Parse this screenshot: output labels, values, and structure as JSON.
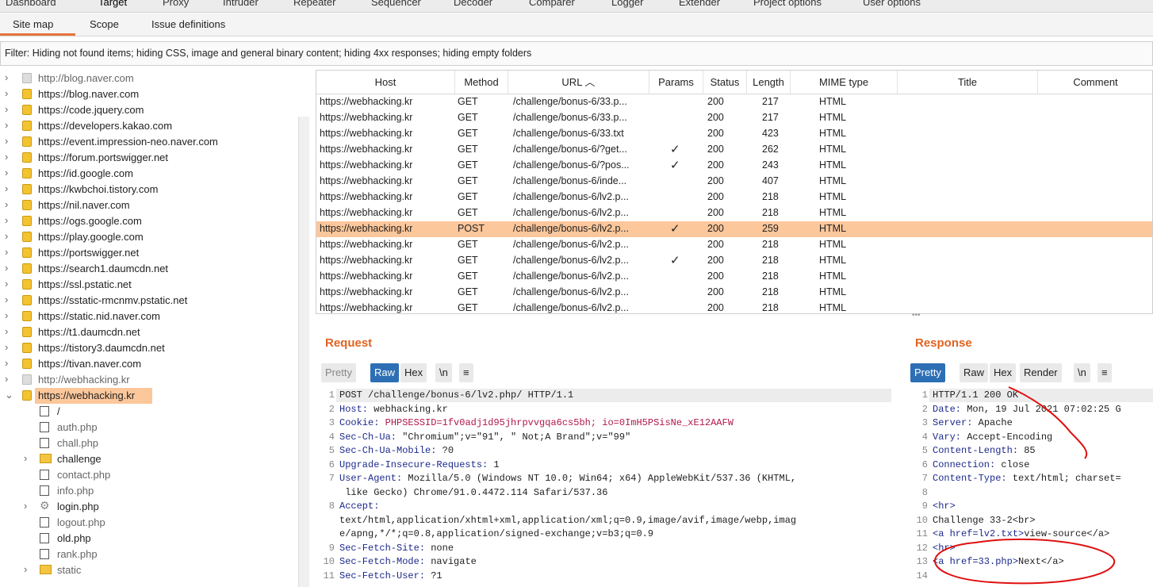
{
  "top_tabs": [
    "Dashboard",
    "Target",
    "Proxy",
    "Intruder",
    "Repeater",
    "Sequencer",
    "Decoder",
    "Comparer",
    "Logger",
    "Extender",
    "Project options",
    "User options"
  ],
  "sub_tabs": [
    "Site map",
    "Scope",
    "Issue definitions"
  ],
  "filter_text": "Filter: Hiding not found items;  hiding CSS, image and general binary content;  hiding 4xx responses;  hiding empty folders",
  "tree": {
    "hosts": [
      {
        "label": "http://blog.naver.com",
        "icon": "host-gray-icon"
      },
      {
        "label": "https://blog.naver.com",
        "icon": "lock-icon"
      },
      {
        "label": "https://code.jquery.com",
        "icon": "lock-icon"
      },
      {
        "label": "https://developers.kakao.com",
        "icon": "lock-icon"
      },
      {
        "label": "https://event.impression-neo.naver.com",
        "icon": "lock-icon"
      },
      {
        "label": "https://forum.portswigger.net",
        "icon": "lock-icon"
      },
      {
        "label": "https://id.google.com",
        "icon": "lock-icon"
      },
      {
        "label": "https://kwbchoi.tistory.com",
        "icon": "lock-icon"
      },
      {
        "label": "https://nil.naver.com",
        "icon": "lock-icon"
      },
      {
        "label": "https://ogs.google.com",
        "icon": "lock-icon"
      },
      {
        "label": "https://play.google.com",
        "icon": "lock-icon"
      },
      {
        "label": "https://portswigger.net",
        "icon": "lock-icon"
      },
      {
        "label": "https://search1.daumcdn.net",
        "icon": "lock-icon"
      },
      {
        "label": "https://ssl.pstatic.net",
        "icon": "lock-icon"
      },
      {
        "label": "https://sstatic-rmcnmv.pstatic.net",
        "icon": "lock-icon"
      },
      {
        "label": "https://static.nid.naver.com",
        "icon": "lock-icon"
      },
      {
        "label": "https://t1.daumcdn.net",
        "icon": "lock-icon"
      },
      {
        "label": "https://tistory3.daumcdn.net",
        "icon": "lock-icon"
      },
      {
        "label": "https://tivan.naver.com",
        "icon": "lock-icon"
      },
      {
        "label": "http://webhacking.kr",
        "icon": "host-gray-icon"
      },
      {
        "label": "https://webhacking.kr",
        "icon": "lock-icon"
      }
    ],
    "children": [
      {
        "label": "/",
        "icon": "file-icon"
      },
      {
        "label": "auth.php",
        "icon": "file-icon"
      },
      {
        "label": "chall.php",
        "icon": "file-icon"
      },
      {
        "label": "challenge",
        "icon": "folder-icon"
      },
      {
        "label": "contact.php",
        "icon": "file-icon"
      },
      {
        "label": "info.php",
        "icon": "file-icon"
      },
      {
        "label": "login.php",
        "icon": "gear-icon"
      },
      {
        "label": "logout.php",
        "icon": "file-icon"
      },
      {
        "label": "old.php",
        "icon": "file-icon"
      },
      {
        "label": "rank.php",
        "icon": "file-icon"
      },
      {
        "label": "static",
        "icon": "folder-icon"
      }
    ]
  },
  "table": {
    "headers": [
      "Host",
      "Method",
      "URL ^",
      "Params",
      "Status",
      "Length",
      "MIME type",
      "Title",
      "Comment"
    ],
    "rows": [
      {
        "host": "https://webhacking.kr",
        "method": "GET",
        "url": "/challenge/bonus-6/33.p...",
        "params": "",
        "status": "200",
        "length": "217",
        "mime": "HTML"
      },
      {
        "host": "https://webhacking.kr",
        "method": "GET",
        "url": "/challenge/bonus-6/33.p...",
        "params": "",
        "status": "200",
        "length": "217",
        "mime": "HTML"
      },
      {
        "host": "https://webhacking.kr",
        "method": "GET",
        "url": "/challenge/bonus-6/33.txt",
        "params": "",
        "status": "200",
        "length": "423",
        "mime": "HTML"
      },
      {
        "host": "https://webhacking.kr",
        "method": "GET",
        "url": "/challenge/bonus-6/?get...",
        "params": "✓",
        "status": "200",
        "length": "262",
        "mime": "HTML"
      },
      {
        "host": "https://webhacking.kr",
        "method": "GET",
        "url": "/challenge/bonus-6/?pos...",
        "params": "✓",
        "status": "200",
        "length": "243",
        "mime": "HTML"
      },
      {
        "host": "https://webhacking.kr",
        "method": "GET",
        "url": "/challenge/bonus-6/inde...",
        "params": "",
        "status": "200",
        "length": "407",
        "mime": "HTML"
      },
      {
        "host": "https://webhacking.kr",
        "method": "GET",
        "url": "/challenge/bonus-6/lv2.p...",
        "params": "",
        "status": "200",
        "length": "218",
        "mime": "HTML"
      },
      {
        "host": "https://webhacking.kr",
        "method": "GET",
        "url": "/challenge/bonus-6/lv2.p...",
        "params": "",
        "status": "200",
        "length": "218",
        "mime": "HTML"
      },
      {
        "host": "https://webhacking.kr",
        "method": "POST",
        "url": "/challenge/bonus-6/lv2.p...",
        "params": "✓",
        "status": "200",
        "length": "259",
        "mime": "HTML"
      },
      {
        "host": "https://webhacking.kr",
        "method": "GET",
        "url": "/challenge/bonus-6/lv2.p...",
        "params": "",
        "status": "200",
        "length": "218",
        "mime": "HTML"
      },
      {
        "host": "https://webhacking.kr",
        "method": "GET",
        "url": "/challenge/bonus-6/lv2.p...",
        "params": "✓",
        "status": "200",
        "length": "218",
        "mime": "HTML"
      },
      {
        "host": "https://webhacking.kr",
        "method": "GET",
        "url": "/challenge/bonus-6/lv2.p...",
        "params": "",
        "status": "200",
        "length": "218",
        "mime": "HTML"
      },
      {
        "host": "https://webhacking.kr",
        "method": "GET",
        "url": "/challenge/bonus-6/lv2.p...",
        "params": "",
        "status": "200",
        "length": "218",
        "mime": "HTML"
      },
      {
        "host": "https://webhacking.kr",
        "method": "GET",
        "url": "/challenge/bonus-6/lv2.p...",
        "params": "",
        "status": "200",
        "length": "218",
        "mime": "HTML"
      }
    ]
  },
  "request": {
    "title": "Request",
    "buttons": [
      "Pretty",
      "Raw",
      "Hex",
      "\\n",
      "≡"
    ],
    "lines": [
      {
        "n": "1",
        "k": "",
        "v": "POST /challenge/bonus-6/lv2.php/ HTTP/1.1"
      },
      {
        "n": "2",
        "k": "Host:",
        "v": " webhacking.kr"
      },
      {
        "n": "3",
        "k": "Cookie:",
        "v": " PHPSESSID=1fv0adj1d95jhrpvvgqa6cs5bh; io=0ImH5PSisNe_xE12AAFW"
      },
      {
        "n": "4",
        "k": "Sec-Ch-Ua:",
        "v": " \"Chromium\";v=\"91\", \" Not;A Brand\";v=\"99\""
      },
      {
        "n": "5",
        "k": "Sec-Ch-Ua-Mobile:",
        "v": " ?0"
      },
      {
        "n": "6",
        "k": "Upgrade-Insecure-Requests:",
        "v": " 1"
      },
      {
        "n": "7",
        "k": "User-Agent:",
        "v": " Mozilla/5.0 (Windows NT 10.0; Win64; x64) AppleWebKit/537.36 (KHTML,"
      },
      {
        "n": "",
        "k": "",
        "v": " like Gecko) Chrome/91.0.4472.114 Safari/537.36"
      },
      {
        "n": "8",
        "k": "Accept:",
        "v": ""
      },
      {
        "n": "",
        "k": "",
        "v": "text/html,application/xhtml+xml,application/xml;q=0.9,image/avif,image/webp,imag"
      },
      {
        "n": "",
        "k": "",
        "v": "e/apng,*/*;q=0.8,application/signed-exchange;v=b3;q=0.9"
      },
      {
        "n": "9",
        "k": "Sec-Fetch-Site:",
        "v": " none"
      },
      {
        "n": "10",
        "k": "Sec-Fetch-Mode:",
        "v": " navigate"
      },
      {
        "n": "11",
        "k": "Sec-Fetch-User:",
        "v": " ?1"
      }
    ]
  },
  "response": {
    "title": "Response",
    "buttons": [
      "Pretty",
      "Raw",
      "Hex",
      "Render",
      "\\n",
      "≡"
    ],
    "lines": [
      {
        "n": "1",
        "k": "",
        "v": "HTTP/1.1 200 OK"
      },
      {
        "n": "2",
        "k": "Date:",
        "v": " Mon, 19 Jul 2021 07:02:25 G"
      },
      {
        "n": "3",
        "k": "Server:",
        "v": " Apache"
      },
      {
        "n": "4",
        "k": "Vary:",
        "v": " Accept-Encoding"
      },
      {
        "n": "5",
        "k": "Content-Length:",
        "v": " 85"
      },
      {
        "n": "6",
        "k": "Connection:",
        "v": " close"
      },
      {
        "n": "7",
        "k": "Content-Type:",
        "v": " text/html; charset="
      },
      {
        "n": "8",
        "k": "",
        "v": ""
      },
      {
        "n": "9",
        "k": "<hr>",
        "v": ""
      },
      {
        "n": "10",
        "k": "",
        "v": "Challenge 33-2<br>"
      },
      {
        "n": "11",
        "k": "<a href=lv2.txt>",
        "v": "view-source</a>"
      },
      {
        "n": "12",
        "k": "<hr>",
        "v": ""
      },
      {
        "n": "13",
        "k": "<a href=33.php>",
        "v": "Next</a>"
      },
      {
        "n": "14",
        "k": "",
        "v": ""
      }
    ]
  },
  "colors": {
    "accent": "#e06321",
    "selected_row": "#fcc79b",
    "active_button": "#2c6fb4",
    "annotation": "#e01010"
  }
}
